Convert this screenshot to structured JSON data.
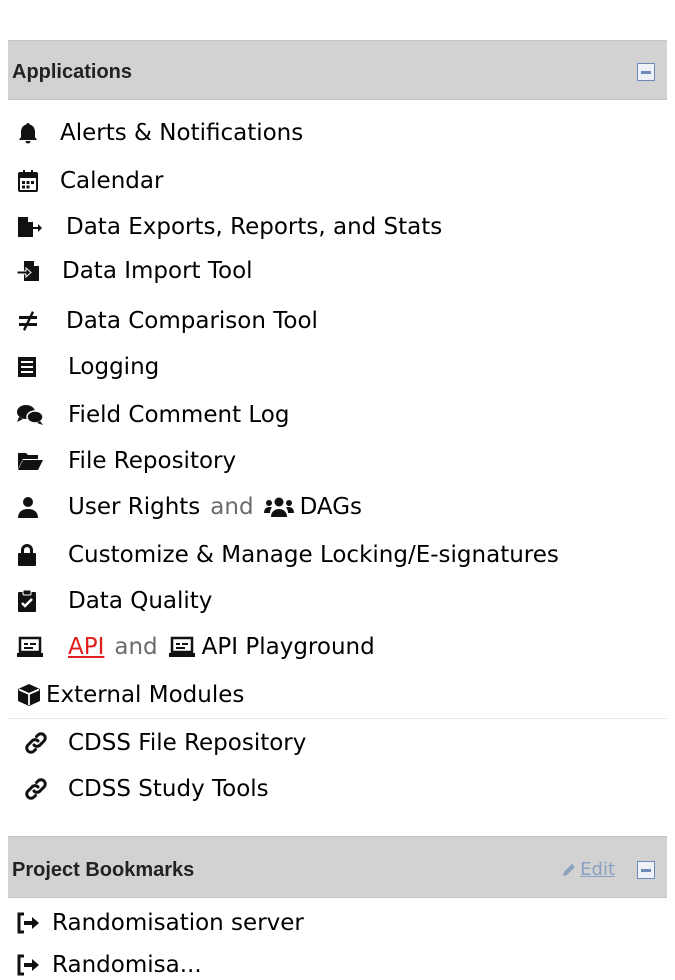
{
  "applications": {
    "title": "Applications",
    "items": [
      {
        "label": "Alerts & Notifications",
        "icon": "bell-icon"
      },
      {
        "label": "Calendar",
        "icon": "calendar-icon"
      },
      {
        "label": "Data Exports, Reports, and Stats",
        "icon": "file-export-icon"
      },
      {
        "label": "Data Import Tool",
        "icon": "file-import-icon"
      },
      {
        "label": "Data Comparison Tool",
        "icon": "not-equal-icon"
      },
      {
        "label": "Logging",
        "icon": "list-icon"
      },
      {
        "label": "Field Comment Log",
        "icon": "comments-icon"
      },
      {
        "label": "File Repository",
        "icon": "folder-open-icon"
      },
      {
        "label": "User Rights",
        "icon": "user-icon",
        "connector": "and",
        "label2": "DAGs",
        "icon2": "users-icon"
      },
      {
        "label": "Customize & Manage Locking/E-signatures",
        "icon": "lock-icon"
      },
      {
        "label": "Data Quality",
        "icon": "clipboard-check-icon"
      },
      {
        "label": "API",
        "icon": "laptop-icon",
        "connector": "and",
        "label2": "API Playground",
        "icon2": "laptop-icon"
      },
      {
        "label": "External Modules",
        "icon": "cube-icon"
      },
      {
        "label": "CDSS File Repository",
        "icon": "link-icon"
      },
      {
        "label": "CDSS Study Tools",
        "icon": "link-icon"
      }
    ]
  },
  "bookmarks": {
    "title": "Project Bookmarks",
    "edit_label": "Edit",
    "items": [
      {
        "label": "Randomisation server",
        "icon": "sign-out-icon"
      },
      {
        "label": "Randomisa...",
        "icon": "sign-out-icon"
      }
    ]
  },
  "colors": {
    "header_bg": "#d2d2d2",
    "api_link": "#e02020",
    "edit_link": "#8aa0c2"
  }
}
